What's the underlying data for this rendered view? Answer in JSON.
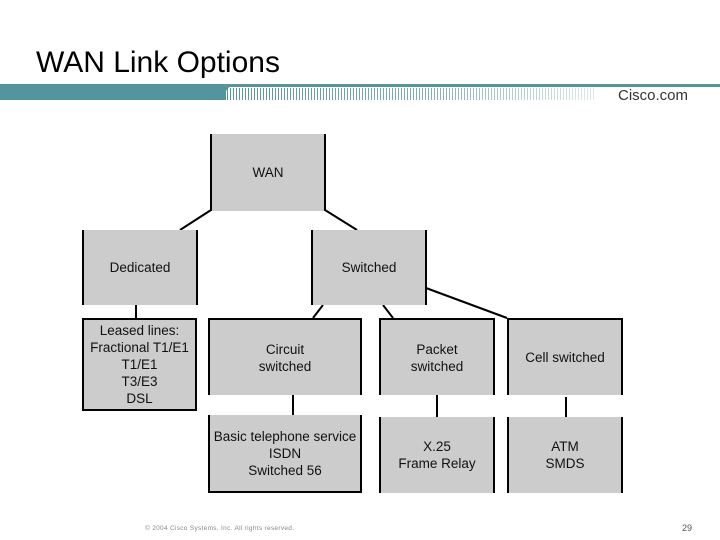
{
  "slide": {
    "title": "WAN Link Options",
    "brand": "Cisco.com",
    "accent_color": "#53959c",
    "footer": "© 2004 Cisco Systems, Inc. All rights reserved.",
    "page_number": "29"
  },
  "diagram": {
    "nodes": {
      "wan": "WAN",
      "dedicated": "Dedicated",
      "switched": "Switched",
      "leased": "Leased lines:\nFractional T1/E1\nT1/E1\nT3/E3\nDSL",
      "circuit": "Circuit\nswitched",
      "packet": "Packet\nswitched",
      "cell": "Cell switched",
      "circuit_examples": "Basic telephone service\nISDN\nSwitched 56",
      "packet_examples": "X.25\nFrame Relay",
      "cell_examples": "ATM\nSMDS"
    },
    "edges": [
      [
        "wan",
        "dedicated"
      ],
      [
        "wan",
        "switched"
      ],
      [
        "dedicated",
        "leased"
      ],
      [
        "switched",
        "circuit"
      ],
      [
        "switched",
        "packet"
      ],
      [
        "switched",
        "cell"
      ],
      [
        "circuit",
        "circuit_examples"
      ],
      [
        "packet",
        "packet_examples"
      ],
      [
        "cell",
        "cell_examples"
      ]
    ]
  }
}
